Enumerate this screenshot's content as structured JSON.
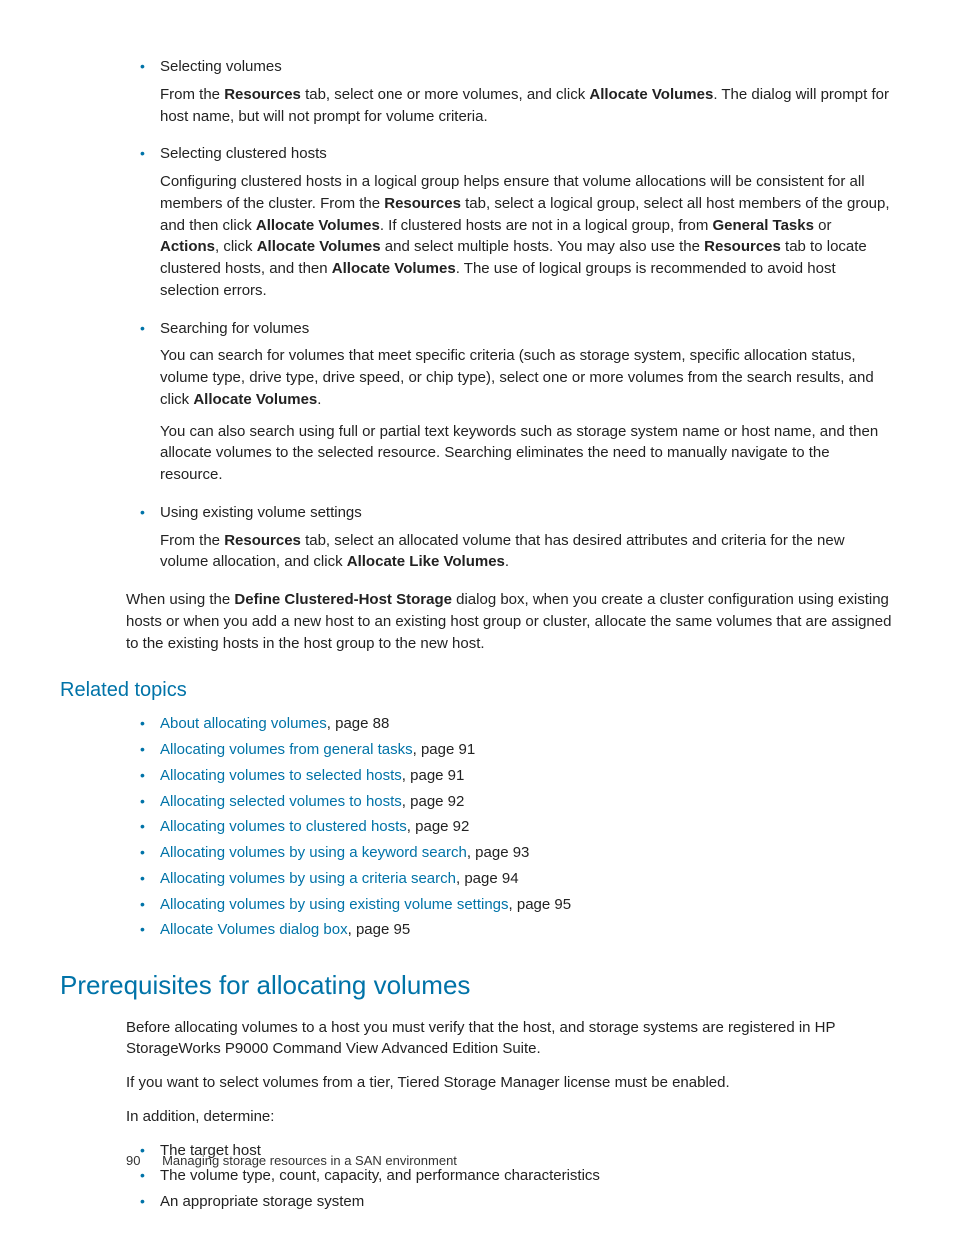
{
  "bullets1": [
    {
      "title": "Selecting volumes",
      "paras": [
        [
          {
            "t": "From the "
          },
          {
            "t": "Resources",
            "b": true
          },
          {
            "t": " tab, select one or more volumes, and click "
          },
          {
            "t": "Allocate Volumes",
            "b": true
          },
          {
            "t": ". The dialog will prompt for host name, but will not prompt for volume criteria."
          }
        ]
      ]
    },
    {
      "title": "Selecting clustered hosts",
      "paras": [
        [
          {
            "t": "Configuring clustered hosts in a logical group helps ensure that volume allocations will be consistent for all members of the cluster. From the "
          },
          {
            "t": "Resources",
            "b": true
          },
          {
            "t": " tab, select a logical group, select all host members of the group, and then click "
          },
          {
            "t": "Allocate Volumes",
            "b": true
          },
          {
            "t": ". If clustered hosts are not in a logical group, from "
          },
          {
            "t": "General Tasks",
            "b": true
          },
          {
            "t": " or "
          },
          {
            "t": "Actions",
            "b": true
          },
          {
            "t": ", click "
          },
          {
            "t": "Allocate Volumes",
            "b": true
          },
          {
            "t": " and select multiple hosts. You may also use the "
          },
          {
            "t": "Resources",
            "b": true
          },
          {
            "t": " tab to locate clustered hosts, and then "
          },
          {
            "t": "Allocate Volumes",
            "b": true
          },
          {
            "t": ". The use of logical groups is recommended to avoid host selection errors."
          }
        ]
      ]
    },
    {
      "title": "Searching for volumes",
      "paras": [
        [
          {
            "t": "You can search for volumes that meet specific criteria (such as storage system, specific allocation status, volume type, drive type, drive speed, or chip type), select one or more volumes from the search results, and click "
          },
          {
            "t": "Allocate Volumes",
            "b": true
          },
          {
            "t": "."
          }
        ],
        [
          {
            "t": "You can also search using full or partial text keywords such as storage system name or host name, and then allocate volumes to the selected resource. Searching eliminates the need to manually navigate to the resource."
          }
        ]
      ]
    },
    {
      "title": "Using existing volume settings",
      "paras": [
        [
          {
            "t": "From the "
          },
          {
            "t": "Resources",
            "b": true
          },
          {
            "t": " tab, select an allocated volume that has desired attributes and criteria for the new volume allocation, and click "
          },
          {
            "t": "Allocate Like Volumes",
            "b": true
          },
          {
            "t": "."
          }
        ]
      ]
    }
  ],
  "closing_para": [
    {
      "t": "When using the "
    },
    {
      "t": "Define Clustered-Host Storage",
      "b": true
    },
    {
      "t": " dialog box, when you create a cluster configuration using existing hosts or when you add a new host to an existing host group or cluster, allocate the same volumes that are assigned to the existing hosts in the host group to the new host."
    }
  ],
  "related_heading": "Related topics",
  "related": [
    {
      "link": "About allocating volumes",
      "suffix": ", page 88"
    },
    {
      "link": "Allocating volumes from general tasks",
      "suffix": ", page 91"
    },
    {
      "link": "Allocating volumes to selected hosts",
      "suffix": ", page 91"
    },
    {
      "link": "Allocating selected volumes to hosts",
      "suffix": ", page 92"
    },
    {
      "link": "Allocating volumes to clustered hosts",
      "suffix": ", page 92"
    },
    {
      "link": "Allocating volumes by using a keyword search",
      "suffix": ", page 93"
    },
    {
      "link": "Allocating volumes by using a criteria search",
      "suffix": ", page 94"
    },
    {
      "link": "Allocating volumes by using existing volume settings",
      "suffix": ", page 95"
    },
    {
      "link": "Allocate Volumes dialog box",
      "suffix": ", page 95"
    }
  ],
  "section_heading": "Prerequisites for allocating volumes",
  "prereq_p1": "Before allocating volumes to a host you must verify that the host, and storage systems are registered in HP StorageWorks P9000 Command View Advanced Edition Suite.",
  "prereq_p2": "If you want to select volumes from a tier, Tiered Storage Manager license must be enabled.",
  "prereq_p3": "In addition, determine:",
  "prereq_list": [
    "The target host",
    "The volume type, count, capacity, and performance characteristics",
    "An appropriate storage system"
  ],
  "footer": {
    "page": "90",
    "title": "Managing storage resources in a SAN environment"
  }
}
